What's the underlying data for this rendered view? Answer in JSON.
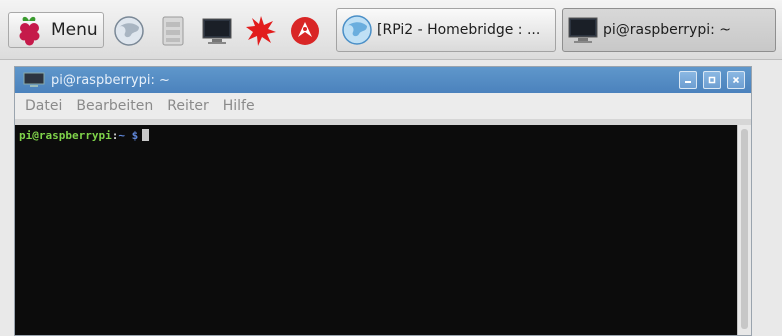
{
  "taskbar": {
    "menu_label": "Menu",
    "launchers": [
      {
        "icon": "globe-icon"
      },
      {
        "icon": "file-manager-icon"
      },
      {
        "icon": "terminal-icon"
      },
      {
        "icon": "burst-icon"
      },
      {
        "icon": "wolfram-icon"
      }
    ],
    "tasks": [
      {
        "label": "[RPi2 - Homebridge : ...",
        "icon": "globe-icon"
      },
      {
        "label": "pi@raspberrypi: ~",
        "icon": "terminal-icon"
      }
    ]
  },
  "window": {
    "title": "pi@raspberrypi: ~",
    "menus": [
      "Datei",
      "Bearbeiten",
      "Reiter",
      "Hilfe"
    ],
    "prompt": {
      "user": "pi@raspberrypi",
      "sep": ":",
      "path": "~ $"
    }
  },
  "colors": {
    "titlebar": "#4b82bd",
    "terminal_bg": "#0c0c0c",
    "prompt_user": "#7fd34a",
    "prompt_path": "#5f86d8"
  }
}
